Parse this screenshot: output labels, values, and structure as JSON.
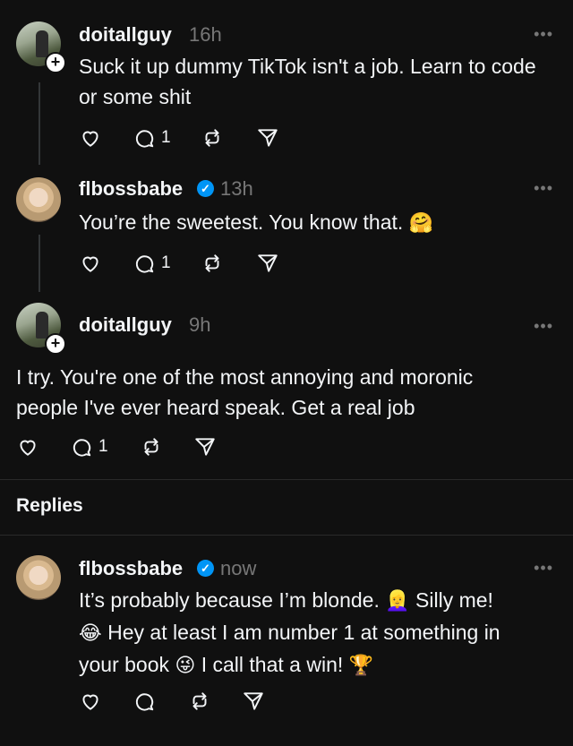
{
  "posts": [
    {
      "username": "doitallguy",
      "time": "16h",
      "verified": false,
      "text": "Suck it up dummy TikTok isn't a job. Learn to code or some shit",
      "replies": "1"
    },
    {
      "username": "flbossbabe",
      "time": "13h",
      "verified": true,
      "text": "You’re the sweetest. You know that.",
      "emoji": "🤗",
      "replies": "1"
    },
    {
      "username": "doitallguy",
      "time": "9h",
      "verified": false,
      "text": "I try. You're one of the most annoying and moronic people I've ever heard speak. Get a real job",
      "replies": "1"
    }
  ],
  "replies_label": "Replies",
  "reply": {
    "username": "flbossbabe",
    "time": "now",
    "verified": true,
    "line1": "It’s probably because I’m blonde.",
    "emoji1": "👱‍♀️",
    "line1b": "Silly me!",
    "emoji2": "😂",
    "line2": "Hey at least I am number 1 at something in",
    "line3": "your book",
    "emoji3": "😜",
    "line3b": "I call that a win!",
    "emoji4": "🏆"
  },
  "icons": {
    "more": "more-options-icon",
    "like": "heart-icon",
    "reply": "comment-icon",
    "repost": "repost-icon",
    "share": "share-icon",
    "verified": "verified-badge-icon",
    "follow": "plus-follow-icon"
  },
  "colors": {
    "background": "#101010",
    "text": "#f3f5f7",
    "muted": "#777777",
    "verified": "#0095f6"
  }
}
